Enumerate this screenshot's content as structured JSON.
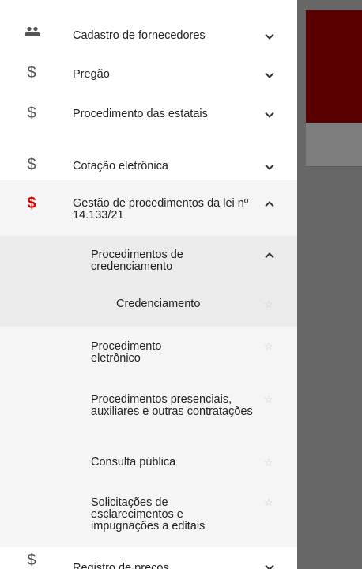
{
  "menu": {
    "items": [
      {
        "label": "Cadastro de fornecedores",
        "icon": "people-icon",
        "chevron": "down"
      },
      {
        "label": "Pregão",
        "icon": "dollar-icon",
        "chevron": "down"
      },
      {
        "label": "Procedimento das estatais",
        "icon": "dollar-icon",
        "chevron": "down"
      },
      {
        "label": "Cotação eletrônica",
        "icon": "dollar-icon",
        "chevron": "down"
      },
      {
        "label": "Gestão de procedimentos da lei nº 14.133/21",
        "icon": "dollar-icon",
        "chevron": "up",
        "active_color": "#d50000"
      },
      {
        "label": "Registro de preços",
        "icon": "dollar-icon",
        "chevron": "down"
      }
    ],
    "dollar_glyph": "$",
    "star_glyph": "☆",
    "sub_items": [
      {
        "label": "Procedimentos de credenciamento",
        "chevron": "up"
      },
      {
        "label": "Credenciamento"
      },
      {
        "label": "Procedimento eletrônico"
      },
      {
        "label": "Procedimentos presenciais, auxiliares e outras contratações"
      },
      {
        "label": "Consulta pública"
      },
      {
        "label": "Solicitações de esclarecimentos e impugnações a editais"
      }
    ]
  },
  "colors": {
    "accent_red": "#d50000",
    "header_dark_red": "#5a0000",
    "overlay_gray": "#676767"
  }
}
